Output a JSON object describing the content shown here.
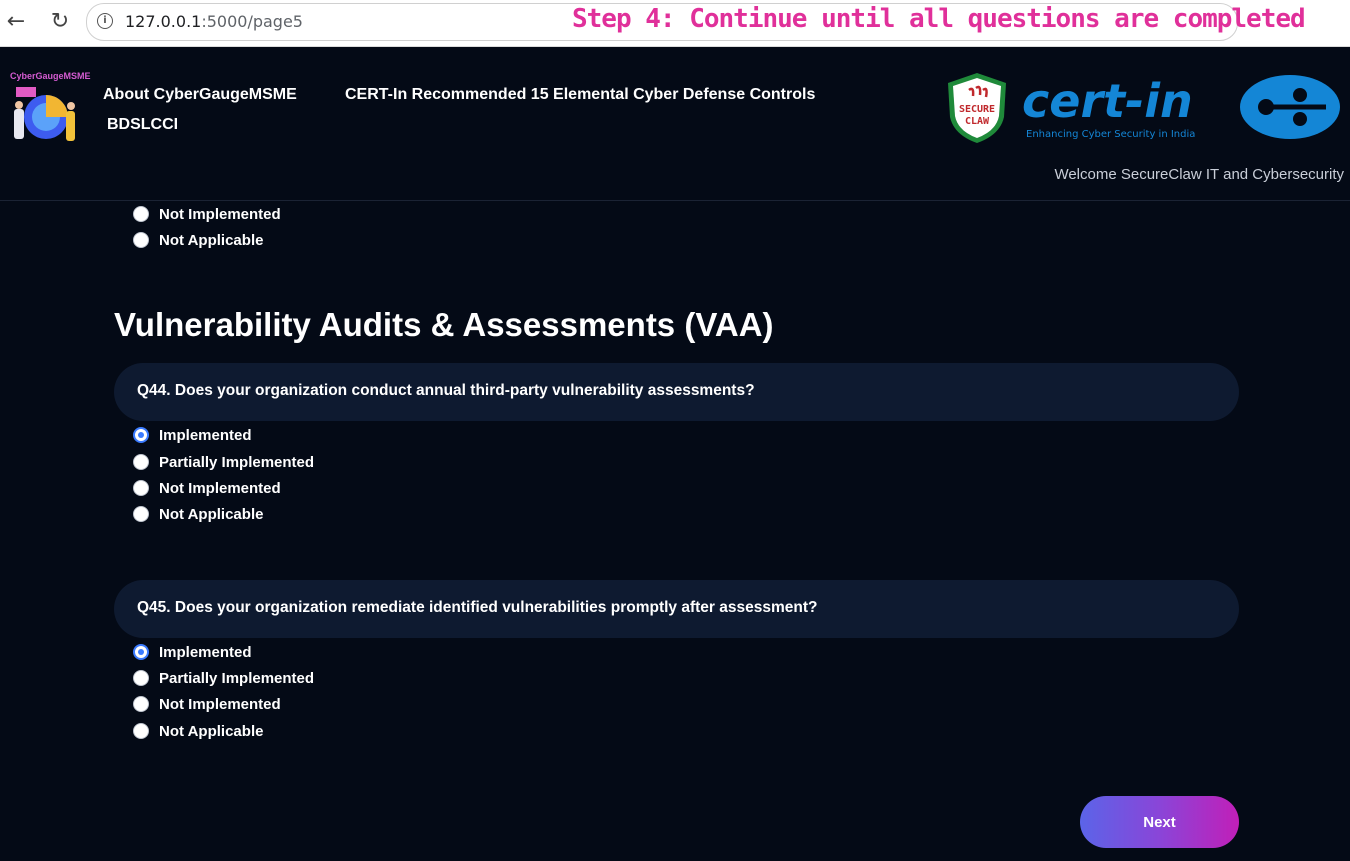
{
  "browser": {
    "url_host": "127.0.0.1",
    "url_path": ":5000/page5",
    "step_banner": "Step 4: Continue until all questions are completed"
  },
  "header": {
    "logo_title": "CyberGaugeMSME",
    "nav": [
      {
        "label": "About CyberGaugeMSME"
      },
      {
        "label": "CERT-In Recommended 15 Elemental Cyber Defense Controls"
      },
      {
        "label": "BDSLCCI"
      }
    ],
    "shield_text_1": "SECURE",
    "shield_text_2": "CLAW",
    "certin_word": "cert-in",
    "certin_tagline": "Enhancing Cyber Security in India",
    "welcome": "Welcome SecureClaw IT and Cybersecurity"
  },
  "previous_options": [
    {
      "label": "Not Implemented",
      "checked": false
    },
    {
      "label": "Not Applicable",
      "checked": false
    }
  ],
  "section": {
    "title": "Vulnerability Audits & Assessments (VAA)"
  },
  "questions": [
    {
      "text": "Q44. Does your organization conduct annual third-party vulnerability assessments?",
      "options": [
        {
          "label": "Implemented",
          "checked": true
        },
        {
          "label": "Partially Implemented",
          "checked": false
        },
        {
          "label": "Not Implemented",
          "checked": false
        },
        {
          "label": "Not Applicable",
          "checked": false
        }
      ]
    },
    {
      "text": "Q45. Does your organization remediate identified vulnerabilities promptly after assessment?",
      "options": [
        {
          "label": "Implemented",
          "checked": true
        },
        {
          "label": "Partially Implemented",
          "checked": false
        },
        {
          "label": "Not Implemented",
          "checked": false
        },
        {
          "label": "Not Applicable",
          "checked": false
        }
      ]
    }
  ],
  "next_label": "Next",
  "colors": {
    "background": "#040a16",
    "question_bg": "#0e1a30",
    "radio_accent": "#3b7bff",
    "banner": "#e0309a"
  }
}
